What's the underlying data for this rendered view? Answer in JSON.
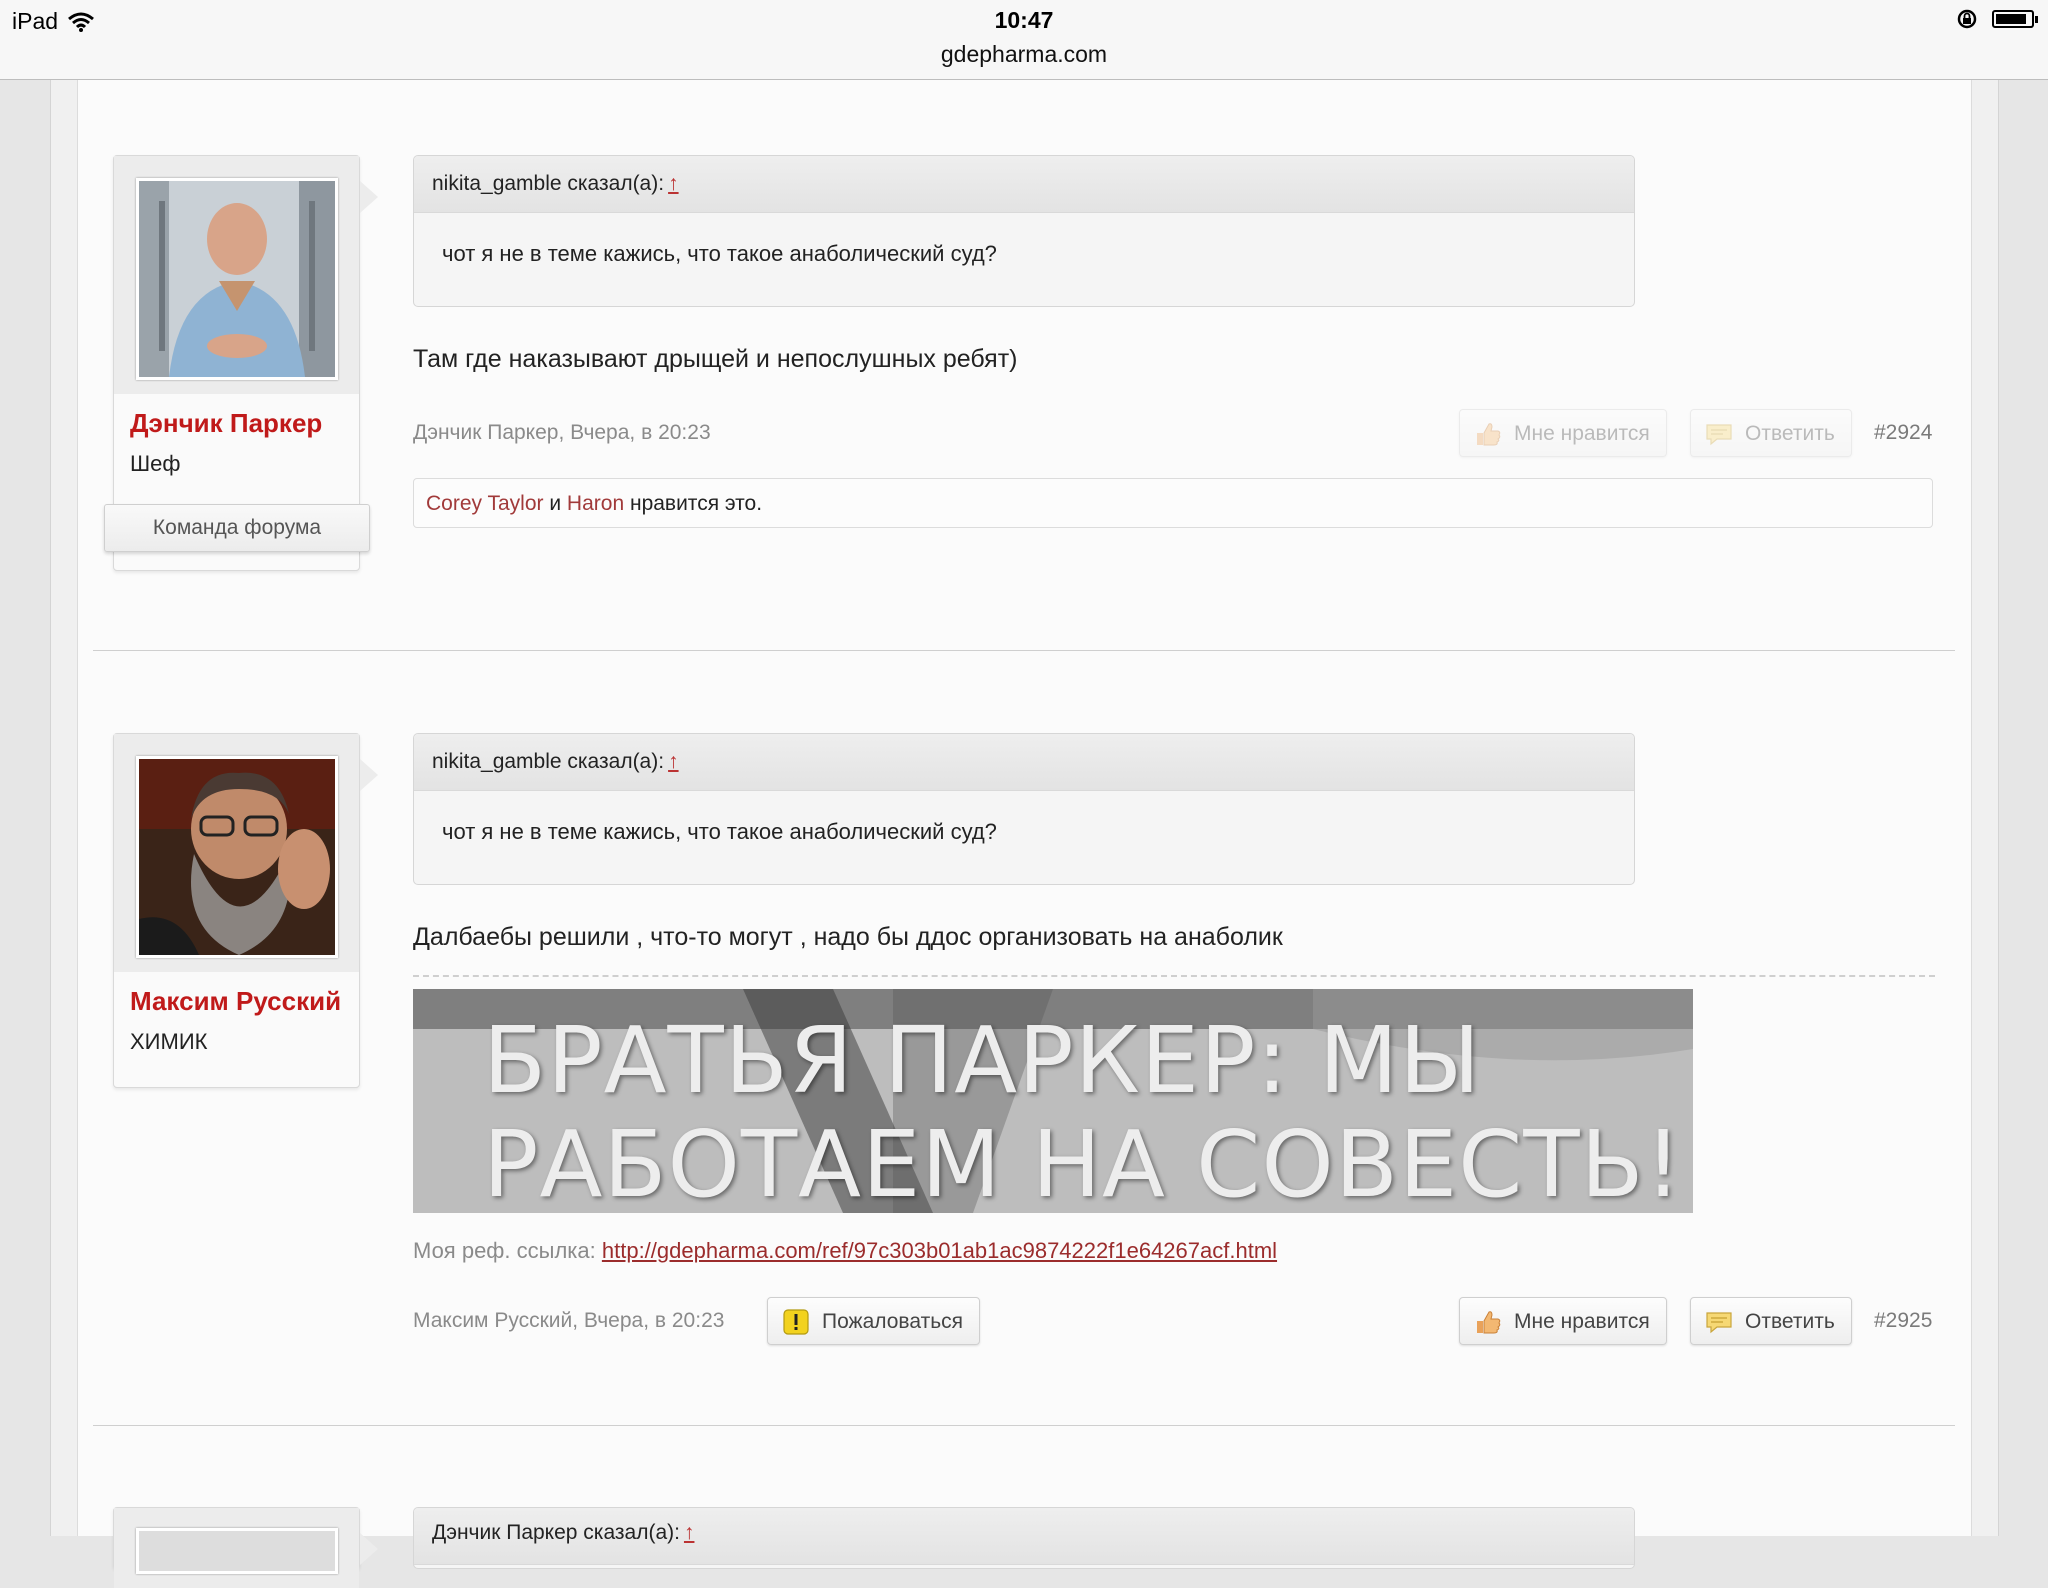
{
  "status_bar": {
    "device": "iPad",
    "time": "10:47",
    "url": "gdepharma.com"
  },
  "posts": [
    {
      "author": "Дэнчик Паркер",
      "user_title": "Шеф",
      "badge": "Команда форума",
      "quote_author": "nikita_gamble сказал(а):",
      "quote_arrow": "↑",
      "quote_text": "чот я не в теме кажись, что такое анаболический суд?",
      "message": "Там где наказывают дрыщей и непослушных ребят)",
      "meta": "Дэнчик Паркер, Вчера, в 20:23",
      "like_label": "Мне нравится",
      "reply_label": "Ответить",
      "post_number": "#2924",
      "likes": {
        "user1": "Corey Taylor",
        "and": "и",
        "user2": "Haron",
        "suffix": "нравится это."
      }
    },
    {
      "author": "Максим Русский",
      "user_title": "ХИМИК",
      "quote_author": "nikita_gamble сказал(а):",
      "quote_arrow": "↑",
      "quote_text": "чот я не в теме кажись, что такое анаболический суд?",
      "message": "Далбаебы решили , что-то могут , надо бы ддос организовать на анаболик",
      "banner_line1": "БРАТЬЯ ПАРКЕР: МЫ",
      "banner_line2": "РАБОТАЕМ НА СОВЕСТЬ!",
      "ref_label": "Моя реф. ссылка:",
      "ref_link": "http://gdepharma.com/ref/97c303b01ab1ac9874222f1e64267acf.html",
      "meta": "Максим Русский, Вчера, в 20:23",
      "report_label": "Пожаловаться",
      "like_label": "Мне нравится",
      "reply_label": "Ответить",
      "post_number": "#2925"
    },
    {
      "quote_author": "Дэнчик Паркер сказал(а):",
      "quote_arrow": "↑"
    }
  ],
  "colors": {
    "author": "#c01a1a",
    "link": "#9b2c2c"
  }
}
